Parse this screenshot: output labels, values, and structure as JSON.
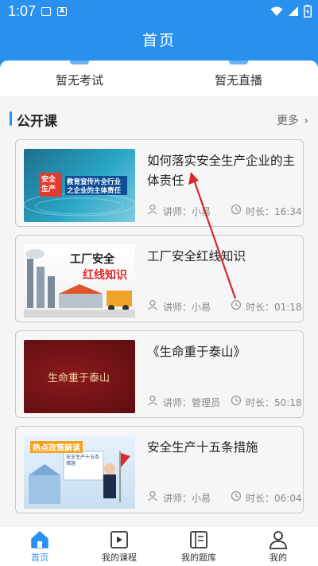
{
  "status_bar": {
    "time": "1:07"
  },
  "header": {
    "title": "首页"
  },
  "tabs": [
    {
      "label": "暂无考试"
    },
    {
      "label": "暂无直播"
    }
  ],
  "section": {
    "title": "公开课",
    "more": "更多"
  },
  "lecturer_prefix": "讲师：",
  "duration_prefix": "时长：",
  "courses": [
    {
      "title": "如何落实安全生产企业的主体责任",
      "lecturer": "小易",
      "duration": "16:34",
      "thumb_text": {
        "badge": "安全生产",
        "line1": "教育宣传片全行业",
        "line2": "之企业的主体责任"
      }
    },
    {
      "title": "工厂安全红线知识",
      "lecturer": "小易",
      "duration": "01:18",
      "thumb_text": {
        "line1": "工厂安全",
        "line2": "红线知识"
      }
    },
    {
      "title": "《生命重于泰山》",
      "lecturer": "管理员",
      "duration": "50:18",
      "thumb_text": {
        "line1": "生命重于泰山"
      }
    },
    {
      "title": "安全生产十五条措施",
      "lecturer": "小易",
      "duration": "06:04",
      "thumb_text": {
        "line1": "热点政策解读",
        "line2": "安全生产十五条措施"
      }
    }
  ],
  "bottom_nav": [
    {
      "label": "首页",
      "icon": "home-icon",
      "active": true
    },
    {
      "label": "我的课程",
      "icon": "video-icon",
      "active": false
    },
    {
      "label": "我的题库",
      "icon": "book-icon",
      "active": false
    },
    {
      "label": "我的",
      "icon": "person-icon",
      "active": false
    }
  ],
  "colors": {
    "primary": "#2a90ed",
    "annotation_arrow": "#d9262c"
  }
}
